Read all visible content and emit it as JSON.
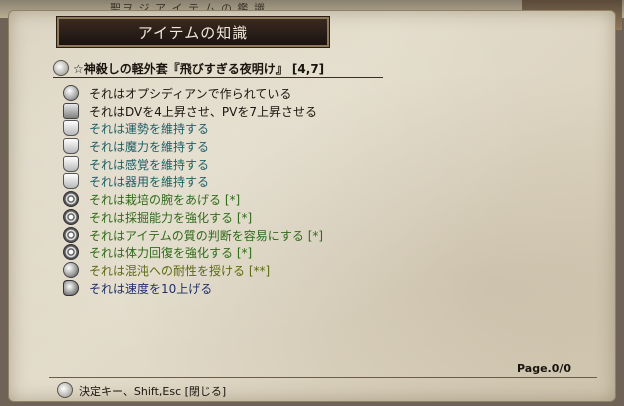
{
  "background": {
    "top_strip_text": "聖ヲ ジ ア イ テ ム の 鑑 識"
  },
  "window": {
    "title": "アイテムの知識"
  },
  "item": {
    "name": "☆神殺しの軽外套『飛びすぎる夜明け』 [4,7]"
  },
  "properties": [
    {
      "icon": "diamond-icon",
      "text": "それはオプシディアンで作られている",
      "color": "#1a140e"
    },
    {
      "icon": "armor-icon",
      "text": "それはDVを4上昇させ、PVを7上昇させる",
      "color": "#1a140e"
    },
    {
      "icon": "cloak-icon",
      "text": "それは運勢を維持する",
      "color": "#1d5f66"
    },
    {
      "icon": "cloak-icon",
      "text": "それは魔力を維持する",
      "color": "#1d5f66"
    },
    {
      "icon": "cloak-icon",
      "text": "それは感覚を維持する",
      "color": "#1d5f66"
    },
    {
      "icon": "cloak-icon",
      "text": "それは器用を維持する",
      "color": "#1d5f66"
    },
    {
      "icon": "swirl-icon",
      "text": "それは栽培の腕をあげる [*]",
      "color": "#2e6b18"
    },
    {
      "icon": "swirl-icon",
      "text": "それは採掘能力を強化する [*]",
      "color": "#2e6b18"
    },
    {
      "icon": "swirl-icon",
      "text": "それはアイテムの質の判断を容易にする [*]",
      "color": "#2e6b18"
    },
    {
      "icon": "swirl-icon",
      "text": "それは体力回復を強化する [*]",
      "color": "#2e6b18"
    },
    {
      "icon": "sphere-icon",
      "text": "それは混沌への耐性を授ける [**]",
      "color": "#5a6a10"
    },
    {
      "icon": "boot-icon",
      "text": "それは速度を10上げる",
      "color": "#1f2f6a"
    }
  ],
  "page_info": "Page.0/0",
  "hint": "決定キー、Shift,Esc [閉じる]"
}
